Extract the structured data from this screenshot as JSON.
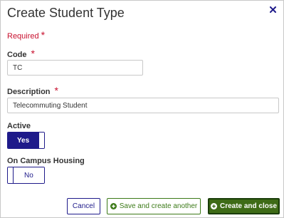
{
  "dialog": {
    "title": "Create Student Type",
    "close_icon": "close-x-icon"
  },
  "form": {
    "required_note": "Required",
    "required_marker": "*",
    "code": {
      "label": "Code",
      "value": "TC"
    },
    "description": {
      "label": "Description",
      "value": "Telecommuting Student"
    },
    "active": {
      "label": "Active",
      "state": "Yes"
    },
    "on_campus_housing": {
      "label": "On Campus Housing",
      "state": "No"
    }
  },
  "footer": {
    "cancel_label": "Cancel",
    "save_another_label": "Save and create another",
    "create_close_label": "Create and close",
    "plus_icon": "plus-circle-icon"
  },
  "colors": {
    "accent_navy": "#1e1a8a",
    "success_green": "#3c7a18",
    "primary_dark_green": "#3e6b16",
    "required_red": "#c8102e"
  }
}
